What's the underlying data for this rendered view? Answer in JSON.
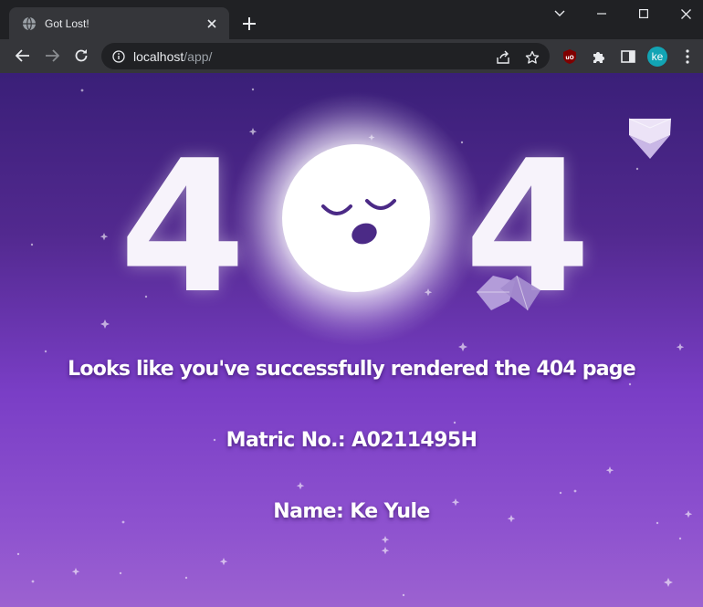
{
  "browser": {
    "tab_title": "Got Lost!",
    "url_host": "localhost",
    "url_path": "/app/",
    "profile_initials": "ke"
  },
  "page": {
    "digit_left": "4",
    "digit_right": "4",
    "message": "Looks like you've successfully rendered the 404 page",
    "matric": "Matric No.: A0211495H",
    "name": "Name: Ke Yule"
  },
  "colors": {
    "chrome_dark": "#202124",
    "chrome_toolbar": "#35363a",
    "bg_top": "#3a1f78",
    "bg_bottom": "#9c62d0",
    "moon_feature": "#4b2a86",
    "avatar": "#12a4b4",
    "ublock": "#800000"
  }
}
